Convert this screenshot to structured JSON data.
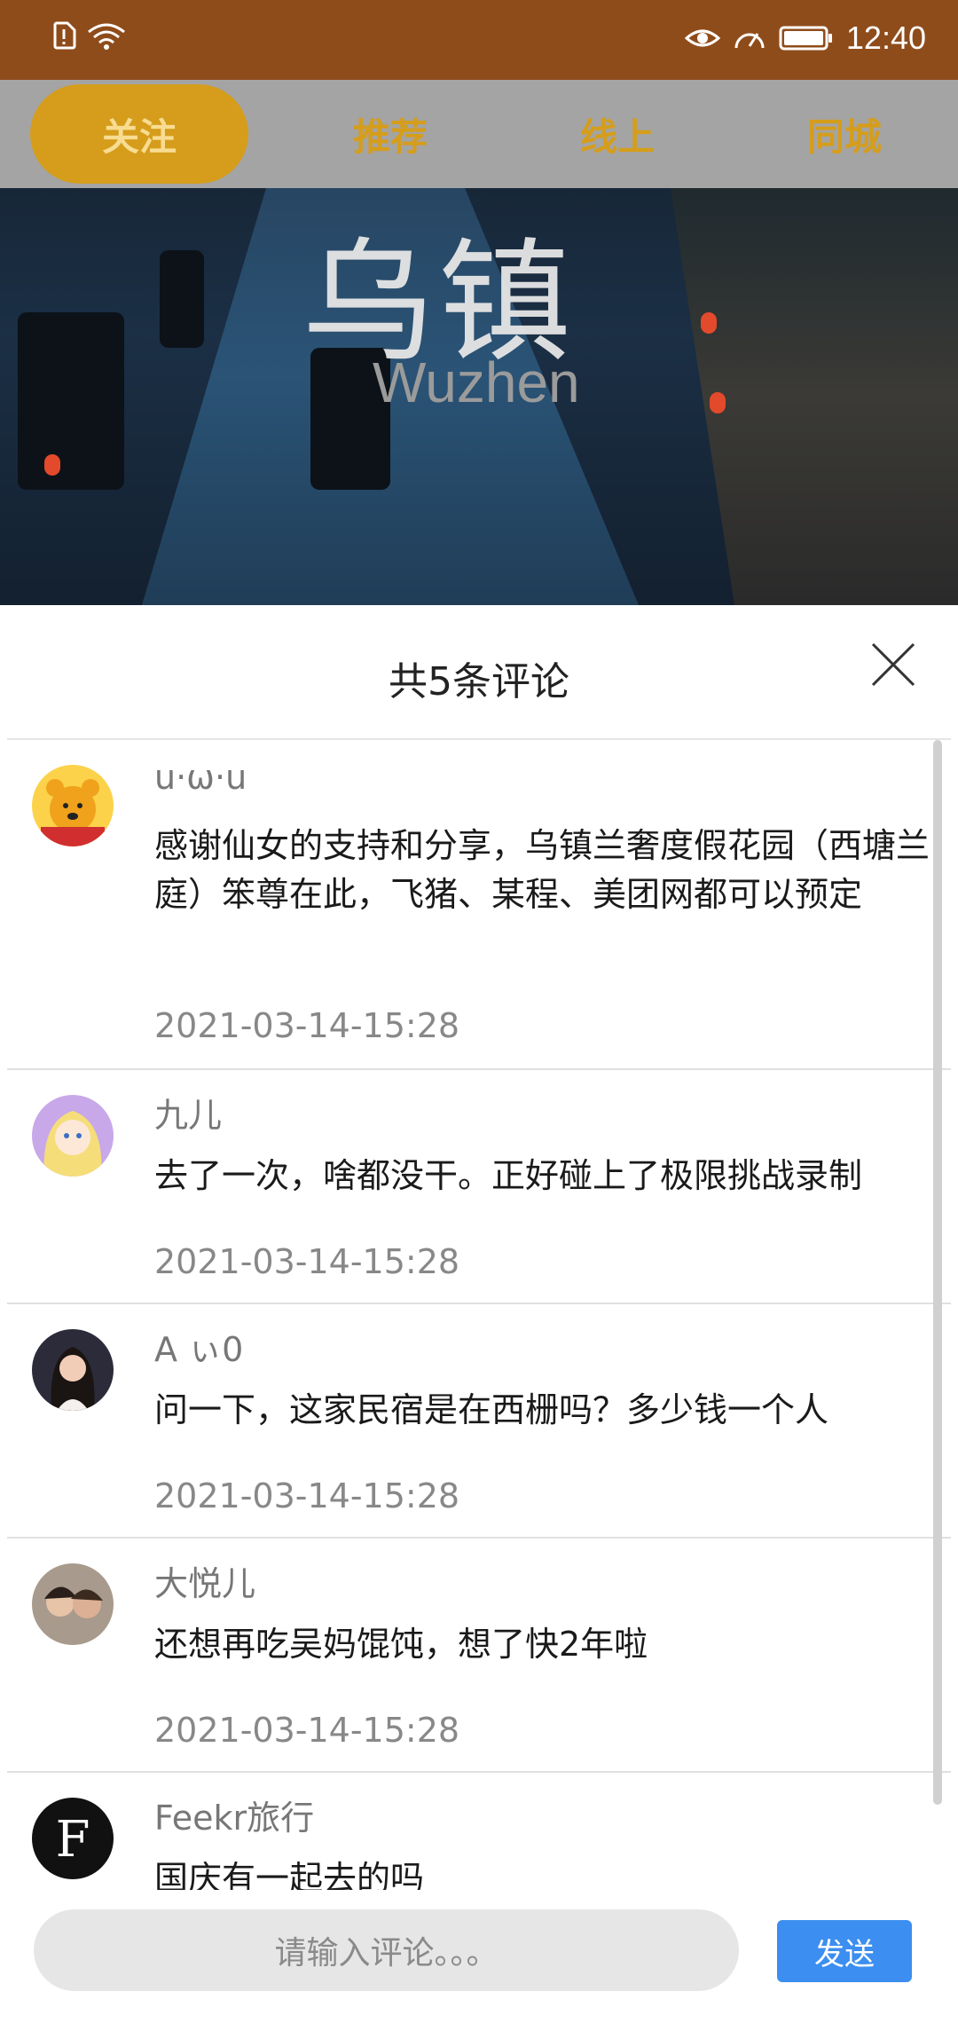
{
  "status": {
    "time": "12:40",
    "icons": [
      "sim-alert-icon",
      "wifi-icon",
      "eye-icon",
      "speed-icon",
      "battery-icon"
    ]
  },
  "tabs": [
    {
      "label": "关注",
      "active": true
    },
    {
      "label": "推荐",
      "active": false
    },
    {
      "label": "线上",
      "active": false
    },
    {
      "label": "同城",
      "active": false
    }
  ],
  "hero": {
    "title_cn": "乌镇",
    "title_en": "Wuzhen"
  },
  "comments_sheet": {
    "title": "共5条评论",
    "comments": [
      {
        "user": "u·ω·u",
        "text": "感谢仙女的支持和分享，乌镇兰奢度假花园（西塘兰庭）笨尊在此，飞猪、某程、美团网都可以预定",
        "date": "2021-03-14-15:28",
        "avatar": "winnie-avatar-icon"
      },
      {
        "user": "九儿",
        "text": "去了一次，啥都没干。正好碰上了极限挑战录制",
        "date": "2021-03-14-15:28",
        "avatar": "anime-girl-avatar-icon"
      },
      {
        "user": "A ぃ0",
        "text": "问一下，这家民宿是在西栅吗？多少钱一个人",
        "date": "2021-03-14-15:28",
        "avatar": "woman-avatar-icon"
      },
      {
        "user": "大悦儿",
        "text": "还想再吃吴妈馄饨，想了快2年啦",
        "date": "2021-03-14-15:28",
        "avatar": "couple-avatar-icon"
      },
      {
        "user": "Feekr旅行",
        "text": "国庆有一起去的吗",
        "date": "",
        "avatar": "feekr-logo-icon"
      }
    ],
    "input_placeholder": "请输入评论。。。",
    "send_label": "发送"
  },
  "colors": {
    "status_bar": "#8f4c1b",
    "tab_accent": "#d59d1b",
    "send_button": "#3c8ef0"
  }
}
